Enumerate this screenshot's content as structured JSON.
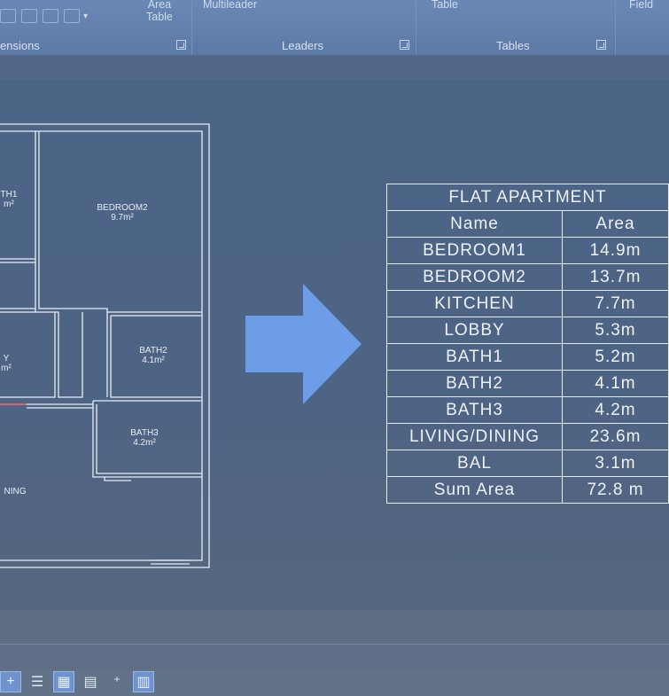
{
  "ribbon": {
    "area_table_label_1": "Area",
    "area_table_label_2": "Table",
    "multileader_label": "Multileader",
    "table_label": "Table",
    "field_label": "Field",
    "panels": {
      "dimensions": "ensions",
      "leaders": "Leaders",
      "tables": "Tables"
    }
  },
  "drawing": {
    "rooms": [
      {
        "name": "TH1",
        "area": "m²"
      },
      {
        "name": "BEDROOM2",
        "area": "9.7m²"
      },
      {
        "name": "Y",
        "area": "m²"
      },
      {
        "name": "BATH2",
        "area": "4.1m²"
      },
      {
        "name": "BATH3",
        "area": "4.2m²"
      },
      {
        "name": "NING",
        "area": ""
      }
    ]
  },
  "table": {
    "title": "FLAT APARTMENT",
    "col_name": "Name",
    "col_area": "Area",
    "rows": [
      {
        "name": "BEDROOM1",
        "area": "14.9m"
      },
      {
        "name": "BEDROOM2",
        "area": "13.7m"
      },
      {
        "name": "KITCHEN",
        "area": "7.7m"
      },
      {
        "name": "LOBBY",
        "area": "5.3m"
      },
      {
        "name": "BATH1",
        "area": "5.2m"
      },
      {
        "name": "BATH2",
        "area": "4.1m"
      },
      {
        "name": "BATH3",
        "area": "4.2m"
      },
      {
        "name": "LIVING/DINING",
        "area": "23.6m"
      },
      {
        "name": "BAL",
        "area": "3.1m"
      }
    ],
    "sum_label": "Sum Area",
    "sum_value": "72.8 m"
  },
  "statusbar": {
    "icons": [
      "ortho-plus-icon",
      "lineweight-icon",
      "transparency-icon",
      "selection-cycling-icon",
      "ucs-icon",
      "annotation-monitor-icon"
    ]
  },
  "colors": {
    "arrow": "#6d9de6",
    "canvas": "#4b6486",
    "ribbon": "#6a87b5"
  }
}
